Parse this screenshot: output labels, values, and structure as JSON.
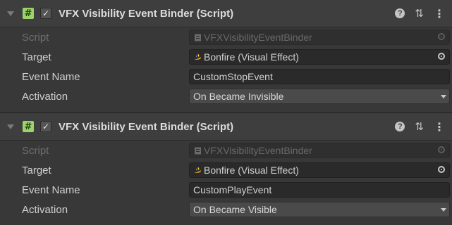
{
  "components": [
    {
      "title": "VFX Visibility Event Binder (Script)",
      "enabled": true,
      "script": {
        "label": "Script",
        "value": "VFXVisibilityEventBinder"
      },
      "target": {
        "label": "Target",
        "value": "Bonfire (Visual Effect)"
      },
      "event_name": {
        "label": "Event Name",
        "value": "CustomStopEvent"
      },
      "activation": {
        "label": "Activation",
        "value": "On Became Invisible"
      }
    },
    {
      "title": "VFX Visibility Event Binder (Script)",
      "enabled": true,
      "script": {
        "label": "Script",
        "value": "VFXVisibilityEventBinder"
      },
      "target": {
        "label": "Target",
        "value": "Bonfire (Visual Effect)"
      },
      "event_name": {
        "label": "Event Name",
        "value": "CustomPlayEvent"
      },
      "activation": {
        "label": "Activation",
        "value": "On Became Visible"
      }
    }
  ],
  "icons": {
    "script": "#",
    "checkbox": "✓",
    "help": "?",
    "presets": "⇅",
    "menu": "⋮"
  },
  "colors": {
    "background": "#383838",
    "header": "#3e3e3e",
    "script_icon": "#9ed36a",
    "field": "#2a2a2a",
    "dropdown": "#4a4a4a"
  }
}
